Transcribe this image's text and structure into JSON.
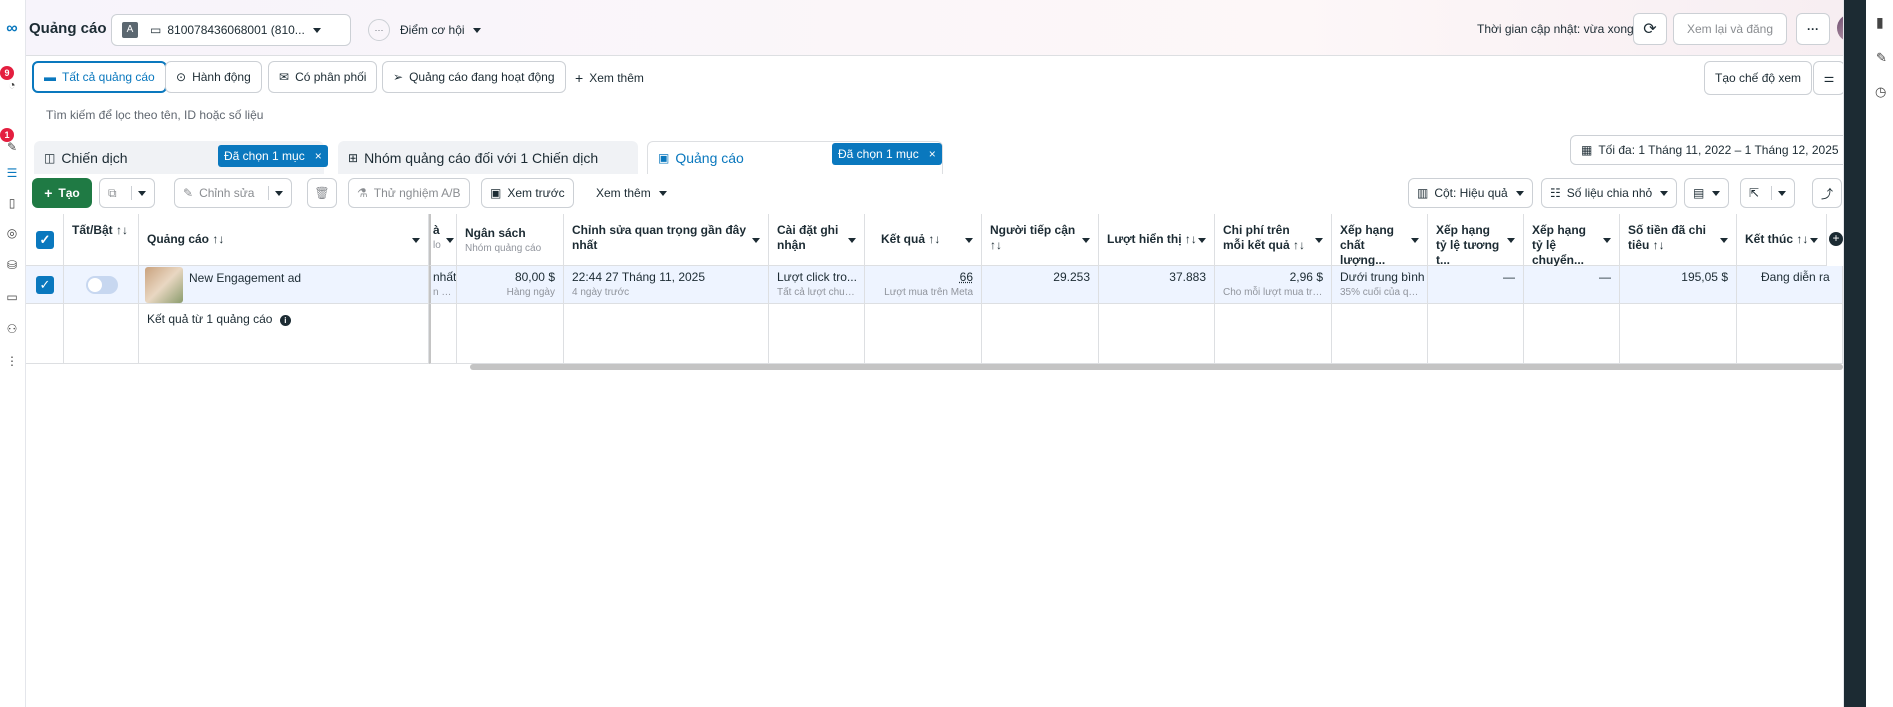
{
  "header": {
    "title": "Quảng cáo",
    "account_badge": "A",
    "account_id": "810078436068001 (810...",
    "opportunity": "Điểm cơ hội",
    "opportunity_icon": "···",
    "updated": "Thời gian cập nhật: vừa xong",
    "review_publish": "Xem lại và đăng",
    "more": "···"
  },
  "left_rail": {
    "badge1": "9",
    "badge2": "1"
  },
  "filter_tabs": [
    {
      "label": "Tất cả quảng cáo"
    },
    {
      "label": "Hành động"
    },
    {
      "label": "Có phân phối"
    },
    {
      "label": "Quảng cáo đang hoạt động"
    },
    {
      "label": "Xem thêm"
    }
  ],
  "create_view": "Tạo chế độ xem",
  "search": {
    "placeholder": "Tìm kiếm để lọc theo tên, ID hoặc số liệu"
  },
  "levels": {
    "campaign": "Chiến dịch",
    "campaign_chip": "Đã chọn 1 mục",
    "adset": "Nhóm quảng cáo đối với 1 Chiến dịch",
    "ad": "Quảng cáo",
    "ad_chip": "Đã chọn 1 mục",
    "chip_close": "×"
  },
  "date_range": "Tối đa: 1 Tháng 11, 2022 – 1 Tháng 12, 2025",
  "toolbar": {
    "create": "Tạo",
    "edit": "Chỉnh sửa",
    "ab_test": "Thử nghiệm A/B",
    "preview": "Xem trước",
    "more": "Xem thêm",
    "columns": "Cột: Hiệu quả",
    "breakdown": "Số liệu chia nhỏ"
  },
  "table": {
    "headers": {
      "toggle": "Tất/Bật ↑↓",
      "ad": "Quảng cáo ↑↓",
      "partial_top": "à",
      "partial_sub": "lo",
      "budget": "Ngân sách",
      "budget_sub": "Nhóm quảng cáo",
      "last_edit": "Chỉnh sửa quan trọng gần đây nhất",
      "attribution": "Cài đặt ghi nhận",
      "results": "Kết quả ↑↓",
      "reach": "Người tiếp cận ↑↓",
      "impressions": "Lượt hiển thị ↑↓",
      "cpr": "Chi phí trên mỗi kết quả ↑↓",
      "quality": "Xếp hạng chất lượng...",
      "engagement_rank": "Xếp hạng tỷ lệ tương t...",
      "conversion_rank": "Xếp hạng tỷ lệ chuyển...",
      "spent": "Số tiền đã chi tiêu ↑↓",
      "end": "Kết thúc ↑↓"
    },
    "row": {
      "ad_name": "New Engagement ad",
      "partial": "nhất",
      "partial_sub": "n n...",
      "budget": "80,00 $",
      "budget_sub": "Hàng ngày",
      "last_edit": "22:44 27 Tháng 11, 2025",
      "last_edit_sub": "4 ngày trước",
      "attribution": "Lượt click tro...",
      "attribution_sub": "Tất cả lượt chuyể...",
      "results": "66",
      "results_sub": "Lượt mua trên Meta",
      "reach": "29.253",
      "impressions": "37.883",
      "cpr": "2,96 $",
      "cpr_sub": "Cho mỗi lượt mua trê...",
      "quality": "Dưới trung bình",
      "quality_sub": "35% cuối của qu...",
      "engagement_rank": "—",
      "conversion_rank": "—",
      "spent": "195,05 $",
      "end": "Đang diễn ra"
    },
    "footer": "Kết quả từ 1 quảng cáo"
  },
  "colors": {
    "accent": "#0a78be",
    "create": "#1f7a44",
    "selected_row": "#eef4ff"
  }
}
